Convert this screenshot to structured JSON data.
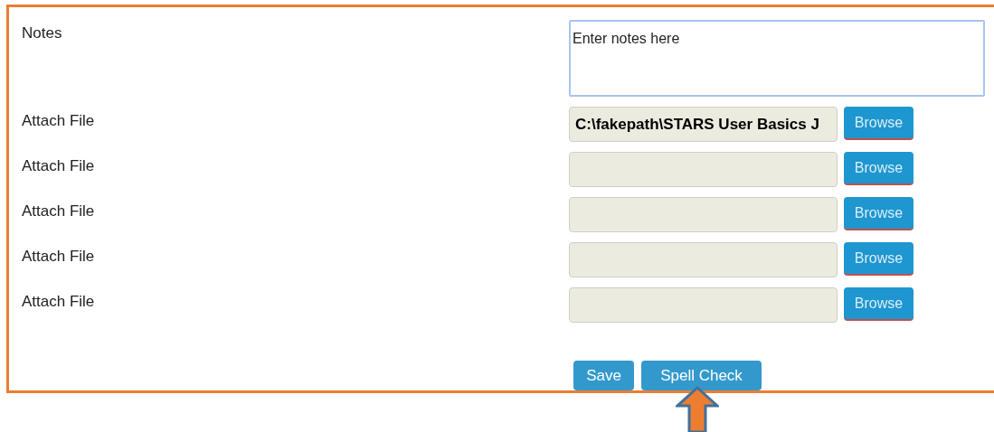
{
  "notes": {
    "label": "Notes",
    "placeholder": "Enter notes here"
  },
  "attachments": [
    {
      "label": "Attach File",
      "value": "C:\\fakepath\\STARS User Basics J",
      "button": "Browse"
    },
    {
      "label": "Attach File",
      "button": "Browse"
    },
    {
      "label": "Attach File",
      "button": "Browse"
    },
    {
      "label": "Attach File",
      "button": "Browse"
    },
    {
      "label": "Attach File",
      "button": "Browse"
    }
  ],
  "buttons": [
    "Save",
    "Spell Check"
  ]
}
